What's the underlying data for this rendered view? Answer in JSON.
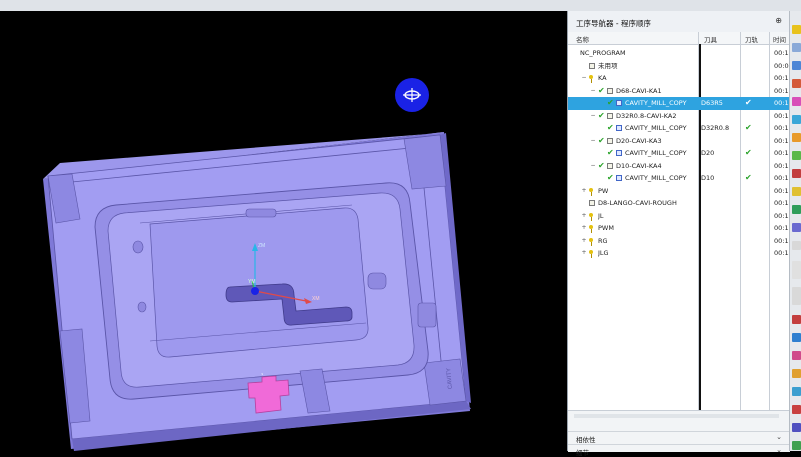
{
  "navigator": {
    "title": "工序导航器 - 程序顺序",
    "pin_glyph": "⊕",
    "columns": {
      "name": "名称",
      "tool": "刀具",
      "toolpath": "刀轨",
      "time": "时间"
    },
    "rows": [
      {
        "name": "NC_PROGRAM",
        "tool": "",
        "toolpath": false,
        "time": "00:1",
        "level": 0,
        "expander": "",
        "check": false,
        "icon": "none"
      },
      {
        "name": "未用项",
        "tool": "",
        "toolpath": false,
        "time": "00:0",
        "level": 1,
        "expander": "",
        "check": false,
        "icon": "folder"
      },
      {
        "name": "KA",
        "tool": "",
        "toolpath": false,
        "time": "00:1",
        "level": 1,
        "expander": "−",
        "check": false,
        "icon": "key"
      },
      {
        "name": "D68-CAVI-KA1",
        "tool": "",
        "toolpath": false,
        "time": "00:1",
        "level": 2,
        "expander": "−",
        "check": true,
        "icon": "folder"
      },
      {
        "name": "CAVITY_MILL_COPY",
        "tool": "D63R5",
        "toolpath": true,
        "time": "00:1",
        "level": 3,
        "expander": "",
        "check": true,
        "icon": "op",
        "selected": true
      },
      {
        "name": "D32R0.8-CAVI-KA2",
        "tool": "",
        "toolpath": false,
        "time": "00:1",
        "level": 2,
        "expander": "−",
        "check": true,
        "icon": "folder"
      },
      {
        "name": "CAVITY_MILL_COPY",
        "tool": "D32R0.8",
        "toolpath": true,
        "time": "00:1",
        "level": 3,
        "expander": "",
        "check": true,
        "icon": "op"
      },
      {
        "name": "D20-CAVI-KA3",
        "tool": "",
        "toolpath": false,
        "time": "00:1",
        "level": 2,
        "expander": "−",
        "check": true,
        "icon": "folder"
      },
      {
        "name": "CAVITY_MILL_COPY",
        "tool": "D20",
        "toolpath": true,
        "time": "00:1",
        "level": 3,
        "expander": "",
        "check": true,
        "icon": "op"
      },
      {
        "name": "D10-CAVI-KA4",
        "tool": "",
        "toolpath": false,
        "time": "00:1",
        "level": 2,
        "expander": "−",
        "check": true,
        "icon": "folder"
      },
      {
        "name": "CAVITY_MILL_COPY",
        "tool": "D10",
        "toolpath": true,
        "time": "00:1",
        "level": 3,
        "expander": "",
        "check": true,
        "icon": "op"
      },
      {
        "name": "PW",
        "tool": "",
        "toolpath": false,
        "time": "00:1",
        "level": 1,
        "expander": "+",
        "check": false,
        "icon": "key"
      },
      {
        "name": "D8-LANGO-CAVI-ROUGH",
        "tool": "",
        "toolpath": false,
        "time": "00:1",
        "level": 1,
        "expander": "",
        "check": false,
        "icon": "folder"
      },
      {
        "name": "JL",
        "tool": "",
        "toolpath": false,
        "time": "00:1",
        "level": 1,
        "expander": "+",
        "check": false,
        "icon": "key"
      },
      {
        "name": "PWM",
        "tool": "",
        "toolpath": false,
        "time": "00:1",
        "level": 1,
        "expander": "+",
        "check": false,
        "icon": "key"
      },
      {
        "name": "RG",
        "tool": "",
        "toolpath": false,
        "time": "00:1",
        "level": 1,
        "expander": "+",
        "check": false,
        "icon": "key"
      },
      {
        "name": "JLG",
        "tool": "",
        "toolpath": false,
        "time": "00:1",
        "level": 1,
        "expander": "+",
        "check": false,
        "icon": "key"
      }
    ],
    "bottom": {
      "related": "相依性",
      "details": "细节"
    }
  },
  "viewport": {
    "axis_labels": {
      "z": "ZM",
      "y": "YM",
      "x": "XM"
    },
    "engraving": "CAVITY"
  },
  "colors": {
    "part_top": "#a29df2",
    "part_side": "#7f79d8",
    "part_edge": "#5a55a8",
    "selected_row": "#2ea3e0",
    "check_green": "#2aa32a",
    "insert_pink": "#f06ad8",
    "view_triad_blue": "#1a22e6"
  }
}
